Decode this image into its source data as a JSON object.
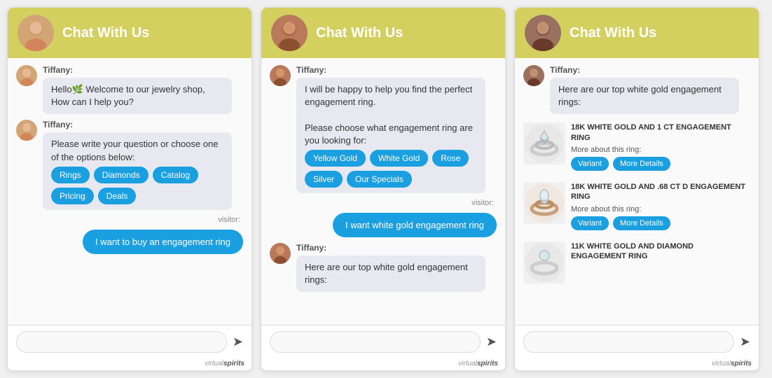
{
  "widgets": [
    {
      "id": "widget-1",
      "header": {
        "title": "Chat With Us"
      },
      "messages": [
        {
          "type": "agent",
          "name": "Tiffany:",
          "text": "Hello🌿 Welcome to our jewelry shop, How can I help you?"
        },
        {
          "type": "agent",
          "name": "Tiffany:",
          "text": "Please write your question or choose one of the options below:",
          "quickReplies": [
            "Rings",
            "Diamonds",
            "Catalog",
            "Pricing",
            "Deals"
          ]
        },
        {
          "type": "visitor-label",
          "text": "visitor:"
        },
        {
          "type": "visitor",
          "text": "I want to buy an engagement ring"
        }
      ],
      "input": {
        "placeholder": ""
      },
      "poweredBy": {
        "text": "virtual",
        "bold": "spirits"
      }
    },
    {
      "id": "widget-2",
      "header": {
        "title": "Chat With Us"
      },
      "messages": [
        {
          "type": "agent",
          "name": "Tiffany:",
          "text": "I will be happy to help you find the perfect engagement ring."
        },
        {
          "type": "agent-cont",
          "text": "Please choose what engagement ring are you looking for:",
          "quickReplies": [
            "Yellow Gold",
            "White Gold",
            "Rose",
            "Silver",
            "Our Specials"
          ]
        },
        {
          "type": "visitor-label",
          "text": "visitor:"
        },
        {
          "type": "visitor",
          "text": "I want white gold engagement ring"
        },
        {
          "type": "agent",
          "name": "Tiffany:",
          "text": "Here are our top white gold engagement rings:"
        }
      ],
      "input": {
        "placeholder": ""
      },
      "poweredBy": {
        "text": "virtual",
        "bold": "spirits"
      }
    },
    {
      "id": "widget-3",
      "header": {
        "title": "Chat With Us"
      },
      "messages": [
        {
          "type": "agent",
          "name": "Tiffany:",
          "text": "Here are our top white gold engagement rings:"
        },
        {
          "type": "products",
          "items": [
            {
              "name": "18K WHITE GOLD AND 1 CT ENGAGEMENT RING",
              "more": "More about this ring:",
              "btns": [
                "Variant",
                "More Details"
              ]
            },
            {
              "name": "18K WHITE GOLD AND .68 CT D ENGAGEMENT RING",
              "more": "More about this ring:",
              "btns": [
                "Variant",
                "More Details"
              ]
            },
            {
              "name": "11K WHITE GOLD AND DIAMOND ENGAGEMENT RING",
              "more": "",
              "btns": []
            }
          ]
        }
      ],
      "input": {
        "placeholder": ""
      },
      "poweredBy": {
        "text": "virtual",
        "bold": "spirits"
      }
    }
  ]
}
